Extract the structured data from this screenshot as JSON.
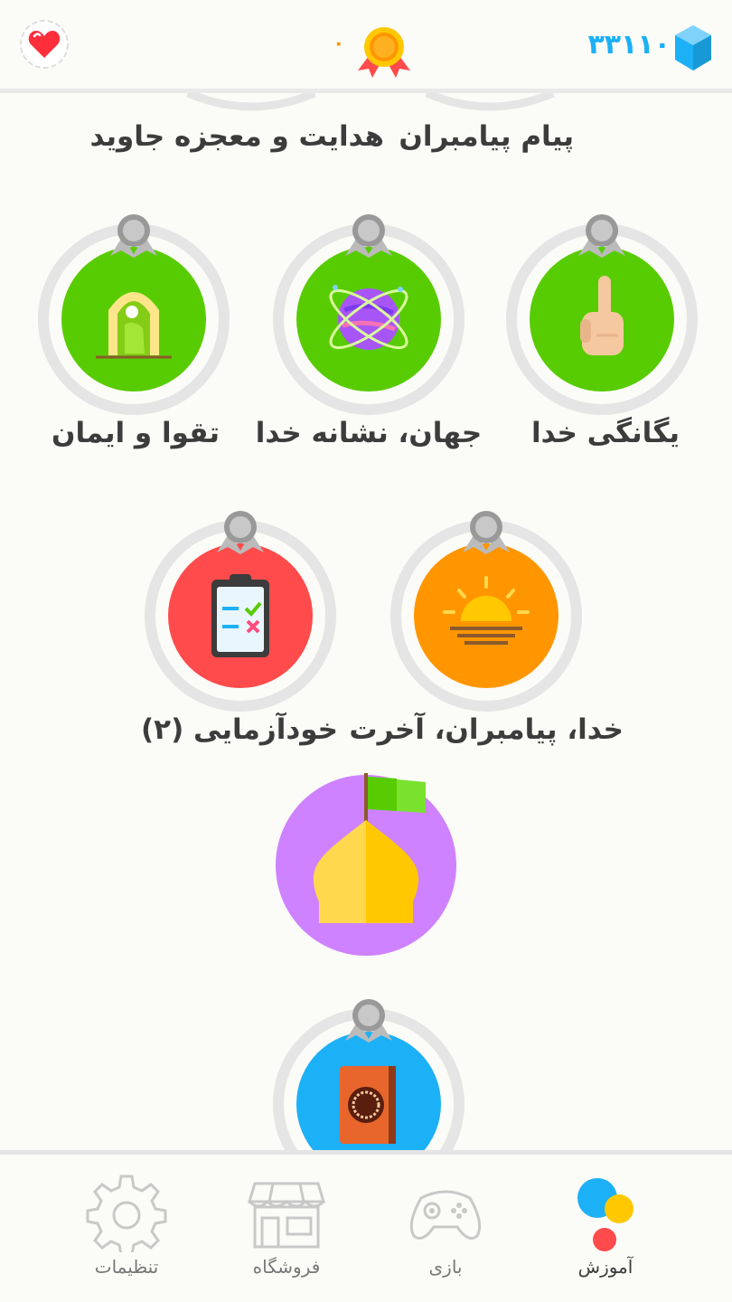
{
  "header": {
    "hearts_icon": "heart-icon",
    "streak_count": "۰",
    "streak_icon": "medal-icon",
    "gems_count": "۳۳۱۱۰",
    "gems_icon": "gem-icon"
  },
  "sections_above": {
    "left_label": "هدایت و معجزه جاوید",
    "right_label": "پیام پیامبران"
  },
  "skills": [
    {
      "label": "یگانگی خدا",
      "icon": "finger-icon",
      "color": "#58cc02"
    },
    {
      "label": "جهان، نشانه خدا",
      "icon": "planet-icon",
      "color": "#58cc02"
    },
    {
      "label": "تقوا و ایمان",
      "icon": "praying-person-icon",
      "color": "#58cc02"
    },
    {
      "label": "خدا، پیامبران، آخرت",
      "icon": "sunrise-icon",
      "color": "#ff9600"
    },
    {
      "label": "خودآزمایی (۲)",
      "icon": "checklist-icon",
      "color": "#ff4b4b"
    },
    {
      "label": "",
      "icon": "quran-icon",
      "color": "#1cb0f6"
    }
  ],
  "checkpoint": {
    "icon": "castle-dome-icon",
    "color": "#ce82ff"
  },
  "tabs": [
    {
      "label": "آموزش",
      "icon": "learn-icon",
      "active": true
    },
    {
      "label": "بازی",
      "icon": "gamepad-icon",
      "active": false
    },
    {
      "label": "فروشگاه",
      "icon": "shop-icon",
      "active": false
    },
    {
      "label": "تنظیمات",
      "icon": "gear-icon",
      "active": false
    }
  ],
  "colors": {
    "accent_blue": "#1cb0f6",
    "green": "#58cc02",
    "orange": "#ff9600",
    "red": "#ff4b4b",
    "purple": "#ce82ff",
    "ring_gray": "#e5e5e5"
  }
}
